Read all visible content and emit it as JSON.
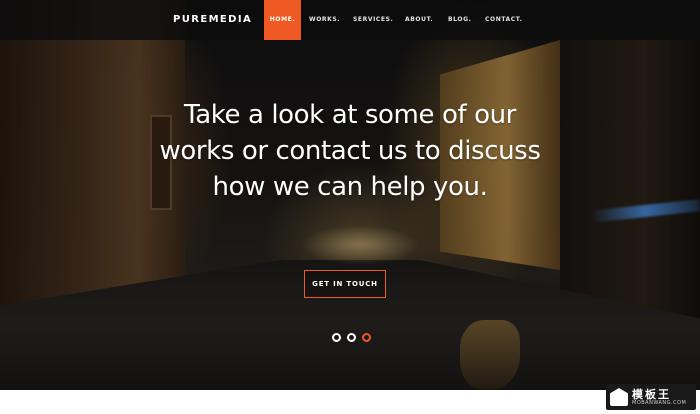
{
  "header": {
    "logo": "PUREMEDIA",
    "nav": [
      {
        "label": "HOME.",
        "active": true
      },
      {
        "label": "WORKS.",
        "active": false
      },
      {
        "label": "SERVICES.",
        "active": false
      },
      {
        "label": "ABOUT.",
        "active": false
      },
      {
        "label": "BLOG.",
        "active": false
      },
      {
        "label": "CONTACT.",
        "active": false
      }
    ]
  },
  "hero": {
    "headline": "Take a look at some of our works or contact us to discuss how we can help you.",
    "cta_label": "GET IN TOUCH",
    "slider": {
      "total": 3,
      "active_index": 2
    }
  },
  "watermark": {
    "title": "模板王",
    "url": "MOBANWANG.COM"
  },
  "colors": {
    "accent": "#ef5a24",
    "nav_bg": "#0c0c0e",
    "text": "#ffffff"
  }
}
